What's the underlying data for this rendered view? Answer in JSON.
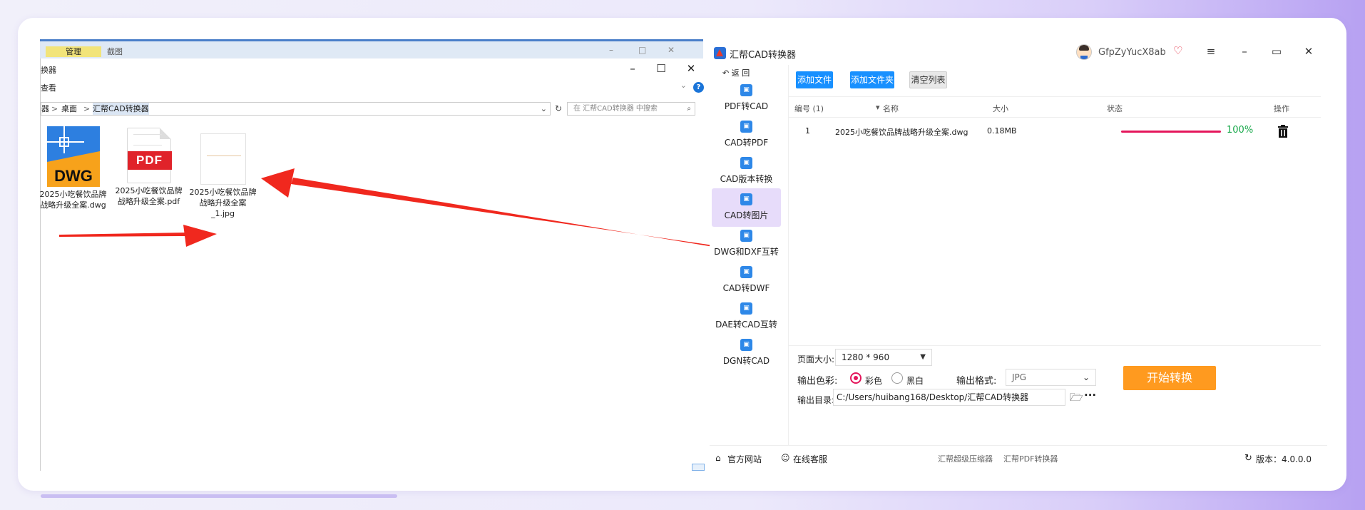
{
  "explorer": {
    "bg_tab_manage": "管理",
    "bg_tab_screenshot": "截图",
    "window_title": "换器",
    "menu_view": "查看",
    "address_root": "器",
    "address_sep1": ">",
    "address_desktop": "桌面",
    "address_sep2": ">",
    "address_current": "汇帮CAD转换器",
    "search_placeholder": "在 汇帮CAD转换器 中搜索",
    "files": [
      {
        "icon": "dwg-file-icon",
        "badge": "DWG",
        "name": "2025小吃餐饮品牌战略升级全案.dwg"
      },
      {
        "icon": "pdf-file-icon",
        "badge": "PDF",
        "name": "2025小吃餐饮品牌战略升级全案.pdf"
      },
      {
        "icon": "jpg-file-icon",
        "badge": "",
        "name": "2025小吃餐饮品牌战略升级全案_1.jpg"
      }
    ]
  },
  "app": {
    "title": "汇帮CAD转换器",
    "username": "GfpZyYucX8ab",
    "back_label": "返 回",
    "nav": [
      {
        "label": "PDF转CAD",
        "active": false
      },
      {
        "label": "CAD转PDF",
        "active": false
      },
      {
        "label": "CAD版本转换",
        "active": false
      },
      {
        "label": "CAD转图片",
        "active": true
      },
      {
        "label": "DWG和DXF互转",
        "active": false
      },
      {
        "label": "CAD转DWF",
        "active": false
      },
      {
        "label": "DAE转CAD互转",
        "active": false
      },
      {
        "label": "DGN转CAD",
        "active": false
      }
    ],
    "toolbar": {
      "add_file": "添加文件",
      "add_folder": "添加文件夹",
      "clear_list": "清空列表"
    },
    "table": {
      "headers": {
        "index": "编号 (1)",
        "name": "名称",
        "size": "大小",
        "status": "状态",
        "action": "操作"
      },
      "rows": [
        {
          "index": "1",
          "name": "2025小吃餐饮品牌战略升级全案.dwg",
          "size": "0.18MB",
          "progress": 1.0,
          "progress_text": "100%"
        }
      ]
    },
    "options": {
      "page_size_label": "页面大小:",
      "page_size_value": "1280 * 960",
      "color_label": "输出色彩:",
      "color_option_color": "彩色",
      "color_option_bw": "黑白",
      "color_selected": "彩色",
      "format_label": "输出格式:",
      "format_value": "JPG",
      "output_dir_label": "输出目录:",
      "output_dir_value": "C:/Users/huibang168/Desktop/汇帮CAD转换器",
      "start_button": "开始转换"
    },
    "footer": {
      "website": "官方网站",
      "support": "在线客服",
      "link1": "汇帮超级压缩器",
      "link2": "汇帮PDF转换器",
      "version": "版本：4.0.0.0"
    }
  },
  "colors": {
    "accent_blue": "#1890ff",
    "progress": "#e4165b",
    "start": "#ff9a1f",
    "arrow": "#f0281e",
    "nav_active": "#e7dcfa"
  }
}
